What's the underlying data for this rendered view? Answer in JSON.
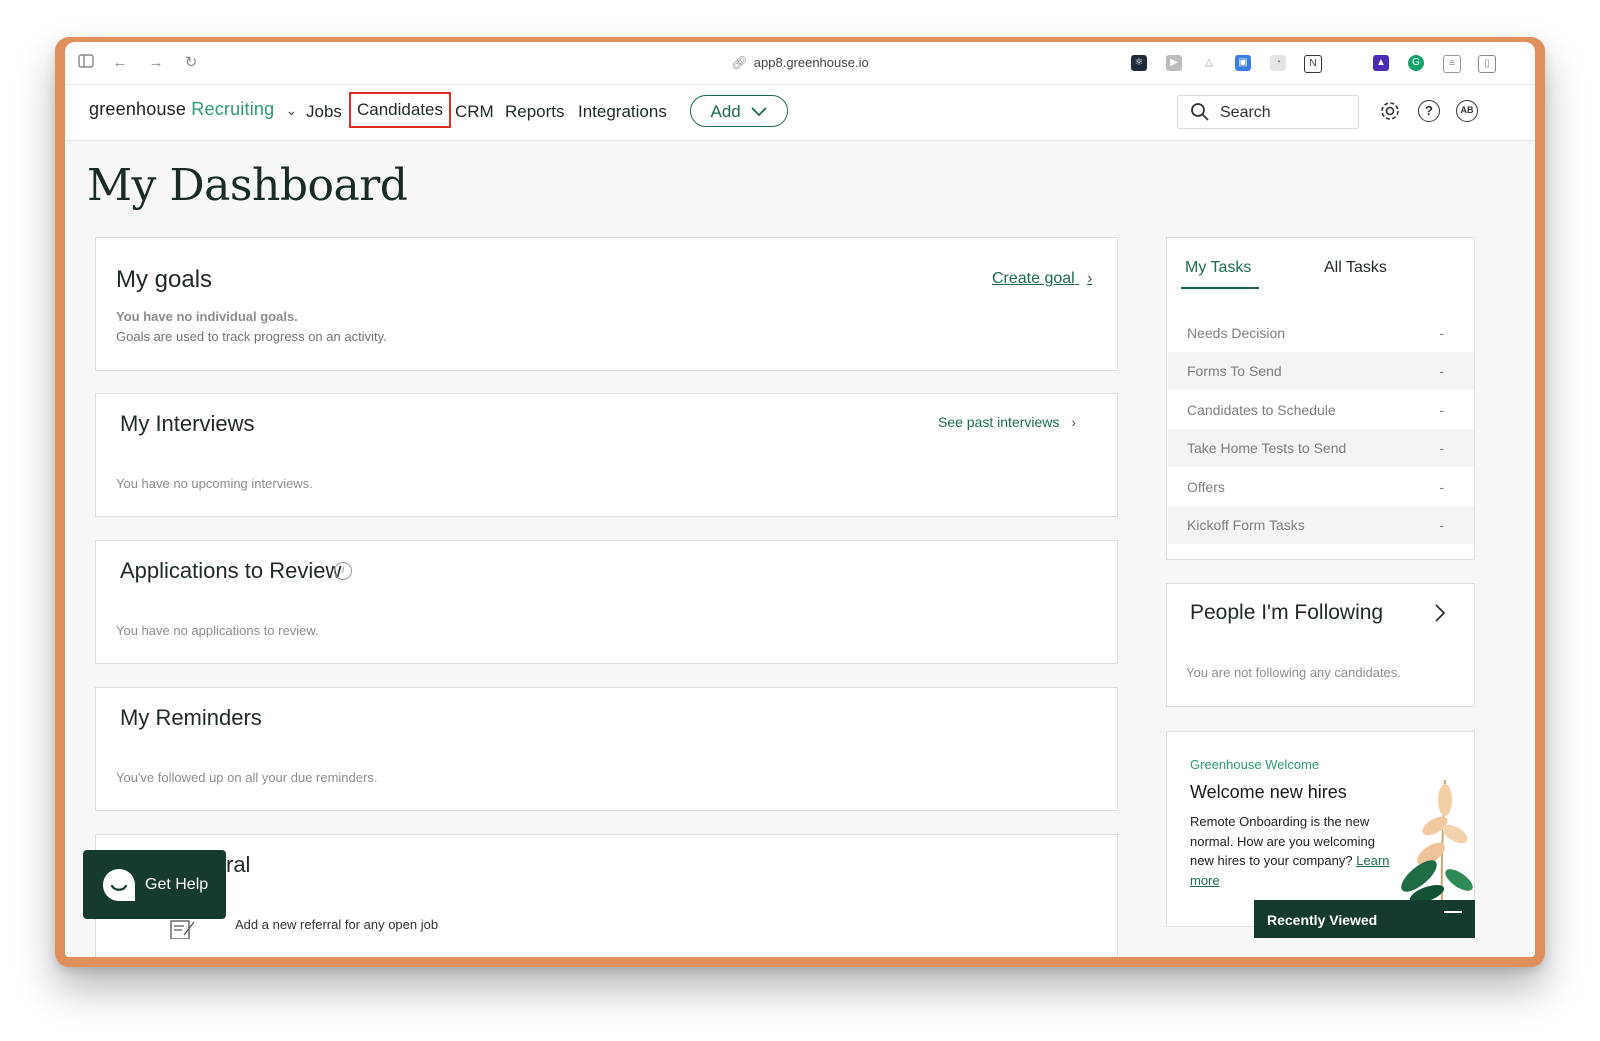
{
  "browser": {
    "url": "app8.greenhouse.io"
  },
  "nav": {
    "logo_main": "greenhouse",
    "logo_product": "Recruiting",
    "items": [
      "Jobs",
      "Candidates",
      "CRM",
      "Reports",
      "Integrations"
    ],
    "add_label": "Add",
    "search_placeholder": "Search",
    "avatar_initials": "AB"
  },
  "page_title": "My Dashboard",
  "goals": {
    "title": "My goals",
    "create_link": "Create goal",
    "empty_title": "You have no individual goals.",
    "empty_desc": "Goals are used to track progress on an activity."
  },
  "interviews": {
    "title": "My Interviews",
    "link": "See past interviews",
    "empty": "You have no upcoming interviews."
  },
  "applications": {
    "title": "Applications to Review",
    "empty": "You have no applications to review."
  },
  "reminders": {
    "title": "My Reminders",
    "empty": "You've followed up on all your due reminders."
  },
  "referral": {
    "title_partial": "ral",
    "desc": "Add a new referral for any open job"
  },
  "tasks": {
    "tab_my": "My Tasks",
    "tab_all": "All Tasks",
    "rows": [
      {
        "label": "Needs Decision",
        "value": "-"
      },
      {
        "label": "Forms To Send",
        "value": "-"
      },
      {
        "label": "Candidates to Schedule",
        "value": "-"
      },
      {
        "label": "Take Home Tests to Send",
        "value": "-"
      },
      {
        "label": "Offers",
        "value": "-"
      },
      {
        "label": "Kickoff Form Tasks",
        "value": "-"
      }
    ]
  },
  "following": {
    "title": "People I'm Following",
    "empty": "You are not following any candidates."
  },
  "welcome": {
    "eyebrow": "Greenhouse Welcome",
    "title": "Welcome new hires",
    "line1": "Remote Onboarding is the new",
    "line2": "normal. How are you welcoming",
    "line3": "new hires to your company?",
    "link1": "Learn",
    "link2": "more"
  },
  "get_help": "Get Help",
  "recently_viewed": "Recently Viewed",
  "colors": {
    "brand_green": "#1d6b4d",
    "dark_green": "#173a2e",
    "highlight": "#e02b20",
    "frame": "#e0905d"
  }
}
